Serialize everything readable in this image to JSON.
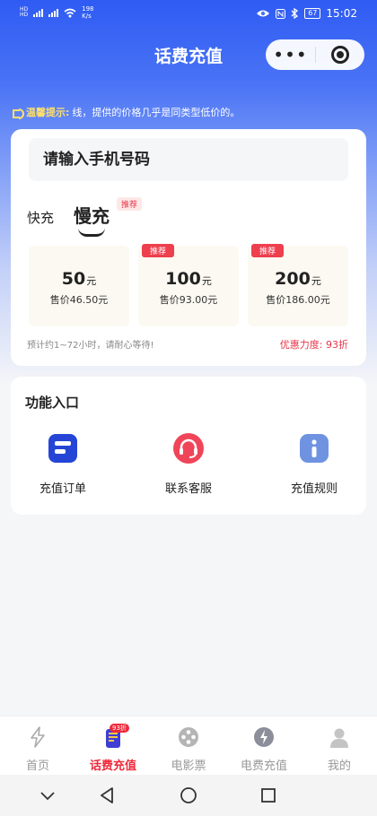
{
  "status_bar": {
    "network_top": "HD",
    "network_bottom": "HD",
    "speed_value": "198",
    "speed_unit": "K/s",
    "battery": "67",
    "time": "15:02"
  },
  "header": {
    "title": "话费充值"
  },
  "tip": {
    "label": "温馨提示:",
    "text": "线，提供的价格几乎是同类型低价的。"
  },
  "recharge": {
    "phone_placeholder": "请输入手机号码",
    "mode_fast": "快充",
    "mode_slow": "慢充",
    "mode_badge": "推荐",
    "amounts": [
      {
        "value": "50",
        "unit": "元",
        "price": "售价46.50元",
        "badge": ""
      },
      {
        "value": "100",
        "unit": "元",
        "price": "售价93.00元",
        "badge": "推荐"
      },
      {
        "value": "200",
        "unit": "元",
        "price": "售价186.00元",
        "badge": "推荐"
      }
    ],
    "hint": "预计约1~72小时，请耐心等待!",
    "discount": "优惠力度: 93折"
  },
  "functions": {
    "title": "功能入口",
    "items": [
      {
        "label": "充值订单",
        "icon": "order-icon"
      },
      {
        "label": "联系客服",
        "icon": "headset-icon"
      },
      {
        "label": "充值规则",
        "icon": "info-icon"
      }
    ]
  },
  "tab_bar": {
    "items": [
      {
        "label": "首页",
        "icon": "lightning-icon"
      },
      {
        "label": "话费充值",
        "icon": "phone-charge-icon",
        "badge": "93折"
      },
      {
        "label": "电影票",
        "icon": "film-reel-icon"
      },
      {
        "label": "电费充值",
        "icon": "bolt-circle-icon"
      },
      {
        "label": "我的",
        "icon": "user-icon"
      }
    ]
  },
  "colors": {
    "brand_blue": "#2f5bf3",
    "accent_red": "#ee2a3b",
    "warning_yellow": "#ffe06b"
  }
}
